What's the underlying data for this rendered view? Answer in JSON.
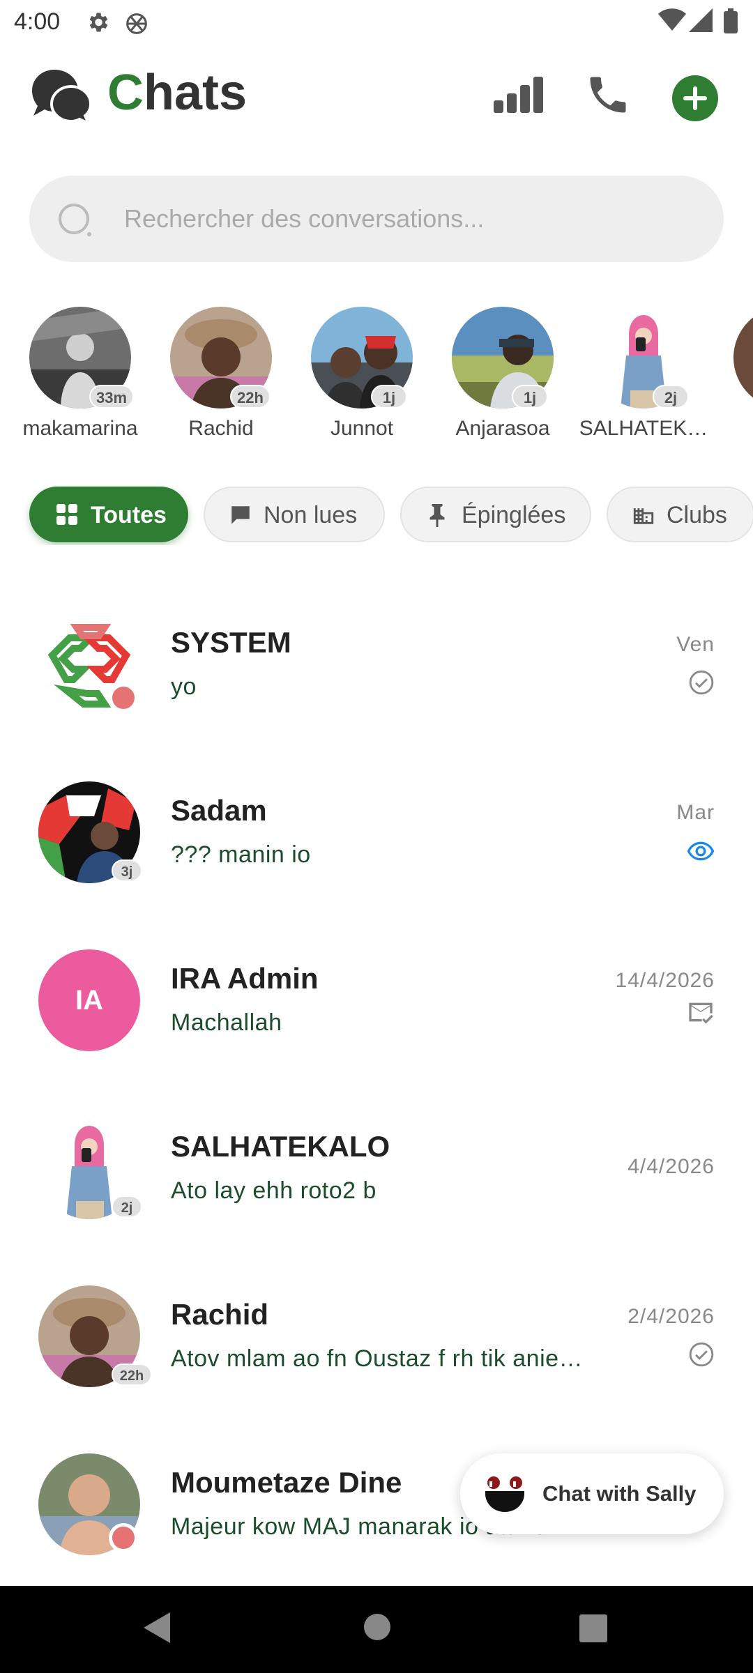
{
  "status_bar": {
    "time": "4:00"
  },
  "header": {
    "title_first": "C",
    "title_rest": "hats"
  },
  "search": {
    "placeholder": "Rechercher des conversations..."
  },
  "stories": [
    {
      "name": "makamarina",
      "badge": "33m"
    },
    {
      "name": "Rachid",
      "badge": "22h"
    },
    {
      "name": "Junnot",
      "badge": "1j"
    },
    {
      "name": "Anjarasoa",
      "badge": "1j"
    },
    {
      "name": "SALHATEK…",
      "badge": "2j"
    }
  ],
  "filters": [
    {
      "label": "Toutes",
      "icon": "grid-icon",
      "active": true
    },
    {
      "label": "Non lues",
      "icon": "chat-bubble-icon",
      "active": false
    },
    {
      "label": "Épinglées",
      "icon": "pin-icon",
      "active": false
    },
    {
      "label": "Clubs",
      "icon": "building-icon",
      "active": false
    }
  ],
  "chats": [
    {
      "name": "SYSTEM",
      "message": "yo",
      "date": "Ven",
      "status": "sent-check-icon"
    },
    {
      "name": "Sadam",
      "message": "??? manin io",
      "date": "Mar",
      "status": "seen-eye-icon",
      "badge": "3j"
    },
    {
      "name": "IRA Admin",
      "initials": "IA",
      "message": "Machallah",
      "date": "14/4/2026",
      "status": "mail-check-icon"
    },
    {
      "name": "SALHATEKALO",
      "message": "Ato lay ehh roto2 b",
      "date": "4/4/2026",
      "badge": "2j"
    },
    {
      "name": "Rachid",
      "message": "Atov mlam ao fn Oustaz f rh tik anie…",
      "date": "2/4/2026",
      "status": "sent-check-icon",
      "badge": "22h"
    },
    {
      "name": "Moumetaze Dine",
      "message": "Majeur kow MAJ manarak io atane…",
      "date": ""
    }
  ],
  "fab": {
    "label": "Chat with Sally"
  },
  "colors": {
    "brand_green": "#2e7d32",
    "online_dot": "#e57373",
    "seen_blue": "#1e88e5",
    "admin_pink": "#ec5b9e"
  }
}
